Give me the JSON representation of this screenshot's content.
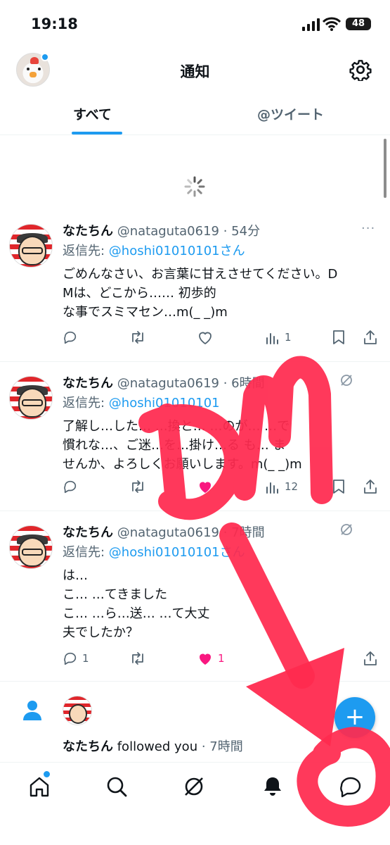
{
  "status": {
    "time": "19:18",
    "battery": "48"
  },
  "header": {
    "title": "通知"
  },
  "tabs": [
    {
      "label": "すべて"
    },
    {
      "label": "@ツイート"
    }
  ],
  "tweets": [
    {
      "name": "なたちん",
      "handle": "@nataguta0619",
      "time": "54分",
      "reply_prefix": "返信先: ",
      "reply_to": "@hoshi01010101さん",
      "text_lines": [
        "ごめんなさい、お言葉に甘えさせてください。D",
        "Mは、どこから……                初歩的",
        "な事でスミマセン…m(_ _)m"
      ],
      "replies": "",
      "likes": "",
      "liked": false,
      "views": "1"
    },
    {
      "name": "なたちん",
      "handle": "@nataguta0619",
      "time": "6時間",
      "reply_prefix": "返信先: ",
      "reply_to": "@hoshi01010101",
      "text_lines": [
        "了解し…した…     …換と…   …のが…     …で",
        "       慣れな…、ご迷…を…掛け…る    も…    ま",
        "せんか、よろしくお願いします。m(_ _)m"
      ],
      "replies": "",
      "likes": "",
      "liked": true,
      "views": "12"
    },
    {
      "name": "なたちん",
      "handle": "@nataguta0619",
      "time": "7時間",
      "reply_prefix": "返信先: ",
      "reply_to": "@hoshi01010101さん",
      "text_lines": [
        "は…",
        "こ…                    …てきました",
        "こ…                    …ら…送…    …て大丈",
        "夫でしたか？"
      ],
      "replies": "1",
      "likes": "1",
      "liked": true,
      "views": ""
    }
  ],
  "follow": {
    "name": "なたちん",
    "text": " followed you",
    "time": " · 7時間"
  },
  "fab": {
    "label": "+"
  },
  "annotation": {
    "text": "DM"
  },
  "icons": [
    "signal-icon",
    "wifi-icon",
    "gear-icon",
    "spinner-icon",
    "reply-icon",
    "retweet-icon",
    "like-icon",
    "views-icon",
    "bookmark-icon",
    "share-icon",
    "grok-icon",
    "person-icon",
    "home-icon",
    "search-icon",
    "bell-icon",
    "messages-icon"
  ],
  "colors": {
    "accent": "#1d9bf0",
    "like": "#f91880",
    "annotation": "#ff2a4f"
  }
}
